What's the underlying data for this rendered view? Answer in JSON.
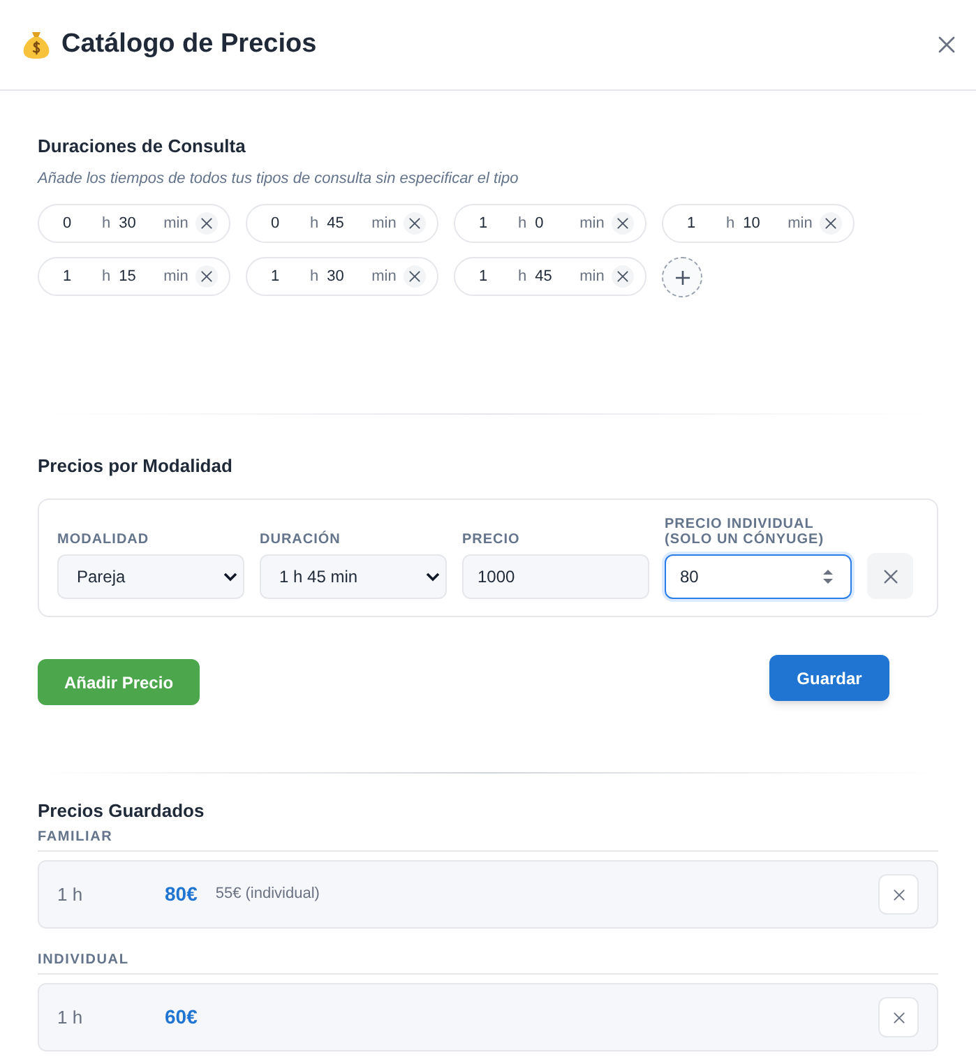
{
  "dialog": {
    "title": "Catálogo de Precios"
  },
  "durations": {
    "title": "Duraciones de Consulta",
    "hint": "Añade los tiempos de todos tus tipos de consulta sin especificar el tipo",
    "items": [
      {
        "hours": "0",
        "hours_unit": "h",
        "minutes": "30",
        "minutes_unit": "min"
      },
      {
        "hours": "0",
        "hours_unit": "h",
        "minutes": "45",
        "minutes_unit": "min"
      },
      {
        "hours": "1",
        "hours_unit": "h",
        "minutes": "0",
        "minutes_unit": "min"
      },
      {
        "hours": "1",
        "hours_unit": "h",
        "minutes": "10",
        "minutes_unit": "min"
      },
      {
        "hours": "1",
        "hours_unit": "h",
        "minutes": "15",
        "minutes_unit": "min"
      },
      {
        "hours": "1",
        "hours_unit": "h",
        "minutes": "30",
        "minutes_unit": "min"
      },
      {
        "hours": "1",
        "hours_unit": "h",
        "minutes": "45",
        "minutes_unit": "min"
      }
    ]
  },
  "pricing": {
    "title": "Precios por Modalidad",
    "rows": [
      {
        "fields": [
          {
            "kind": "select",
            "label": "MODALIDAD",
            "value": "Pareja",
            "focused": false
          },
          {
            "kind": "select",
            "label": "DURACIÓN",
            "value": "1 h 45 min",
            "focused": false
          },
          {
            "kind": "text",
            "label": "PRECIO",
            "value": "1000",
            "focused": false
          },
          {
            "kind": "number",
            "label": "PRECIO INDIVIDUAL (SOLO UN CÓNYUGE)",
            "value": "80",
            "focused": true
          }
        ]
      }
    ],
    "add_button": "Añadir Precio",
    "save_button": "Guardar"
  },
  "saved": {
    "title": "Precios Guardados",
    "groups": [
      {
        "name": "FAMILIAR",
        "items": [
          {
            "duration": "1 h",
            "price": "80€",
            "individual_price": "55€ (individual)"
          }
        ]
      },
      {
        "name": "INDIVIDUAL",
        "items": [
          {
            "duration": "1 h",
            "price": "60€"
          }
        ]
      }
    ]
  }
}
